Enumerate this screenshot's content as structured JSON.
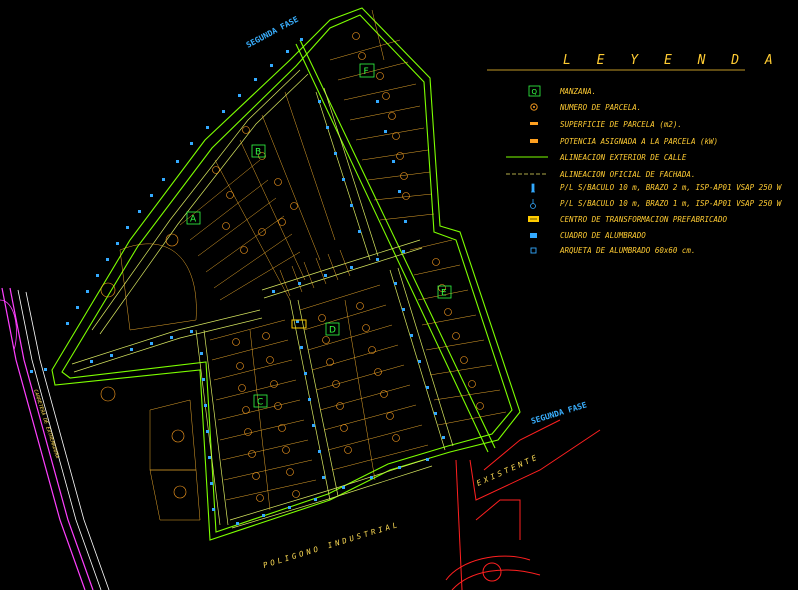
{
  "legend": {
    "title": "L E Y E N D A",
    "items": [
      {
        "symbol": "block-marker-icon",
        "label": "MANZANA."
      },
      {
        "symbol": "plot-number-icon",
        "label": "NUMERO DE PARCELA."
      },
      {
        "symbol": "plot-area-icon",
        "label": "SUPERFICIE DE PARCELA (m2)."
      },
      {
        "symbol": "assigned-power-icon",
        "label": "POTENCIA ASIGNADA A LA PARCELA (kW)"
      },
      {
        "symbol": "street-alignment-line-icon",
        "label": "ALINEACION EXTERIOR DE CALLE"
      },
      {
        "symbol": "facade-alignment-dashed-icon",
        "label": "ALINEACION OFICIAL DE FACHADA."
      },
      {
        "symbol": "lamp-2m-icon",
        "label": "P/L S/BACULO 10 m, BRAZO 2 m, ISP-AP01 VSAP 250 W"
      },
      {
        "symbol": "lamp-1m-icon",
        "label": "P/L S/BACULO 10 m, BRAZO 1 m, ISP-AP01 VSAP 250 W"
      },
      {
        "symbol": "transformer-icon",
        "label": "CENTRO DE TRANSFORMACION PREFABRICADO"
      },
      {
        "symbol": "lighting-panel-icon",
        "label": "CUADRO DE ALUMBRADO"
      },
      {
        "symbol": "junction-box-icon",
        "label": "ARQUETA DE ALUMBRADO 60x60 cm."
      }
    ]
  },
  "blocks": [
    "A",
    "B",
    "C",
    "D",
    "E",
    "F"
  ],
  "streets": {
    "segunda_fase_top": "SEGUNDA FASE",
    "segunda_fase_right": "SEGUNDA FASE",
    "poligono_industrial": "POLIGONO  INDUSTRIAL",
    "existente": "EXISTENTE",
    "carretera": "CARRETERA DE EXTREMADURA"
  },
  "colors": {
    "background": "#000000",
    "legend_text": "#ffcc33",
    "street_alignment": "#7dff00",
    "facade_alignment": "#e8e060",
    "plot_lines": "#ffb830",
    "block_markers": "#33ff44",
    "lamps": "#33aaff",
    "existing_road": "#ff2020",
    "highway": "#ff40ff"
  }
}
